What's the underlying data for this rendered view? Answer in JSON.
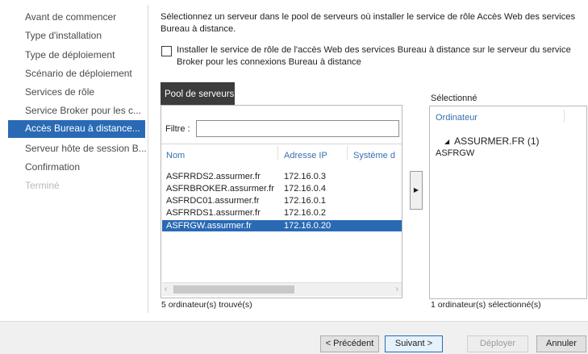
{
  "nav": {
    "items": [
      {
        "label": "Avant de commencer",
        "state": "normal"
      },
      {
        "label": "Type d'installation",
        "state": "normal"
      },
      {
        "label": "Type de déploiement",
        "state": "normal"
      },
      {
        "label": "Scénario de déploiement",
        "state": "normal"
      },
      {
        "label": "Services de rôle",
        "state": "normal"
      },
      {
        "label": "Service Broker pour les c...",
        "state": "normal"
      },
      {
        "label": "Accès Bureau à distance...",
        "state": "active"
      },
      {
        "label": "Serveur hôte de session B...",
        "state": "normal"
      },
      {
        "label": "Confirmation",
        "state": "normal"
      },
      {
        "label": "Terminé",
        "state": "disabled"
      }
    ]
  },
  "main": {
    "description": "Sélectionnez un serveur dans le pool de serveurs où installer le service de rôle Accès Web des services Bureau à distance.",
    "checkbox_label": "Installer le service de rôle de l'accès Web des services Bureau à distance sur le serveur du service Broker pour les connexions Bureau à distance",
    "checkbox_checked": false
  },
  "pool": {
    "tab_label": "Pool de serveurs",
    "filter_label": "Filtre :",
    "filter_value": "",
    "columns": [
      "Nom",
      "Adresse IP",
      "Système d"
    ],
    "rows": [
      {
        "name": "ASFRRDS2.assurmer.fr",
        "ip": "172.16.0.3",
        "selected": false
      },
      {
        "name": "ASFRBROKER.assurmer.fr",
        "ip": "172.16.0.4",
        "selected": false
      },
      {
        "name": "ASFRDC01.assurmer.fr",
        "ip": "172.16.0.1",
        "selected": false
      },
      {
        "name": "ASFRRDS1.assurmer.fr",
        "ip": "172.16.0.2",
        "selected": false
      },
      {
        "name": "ASFRGW.assurmer.fr",
        "ip": "172.16.0.20",
        "selected": true
      }
    ],
    "found_count": "5 ordinateur(s) trouvé(s)"
  },
  "selected": {
    "title": "Sélectionné",
    "column": "Ordinateur",
    "group": "ASSURMER.FR (1)",
    "items": [
      "ASFRGW"
    ],
    "count": "1 ordinateur(s) sélectionné(s)"
  },
  "footer": {
    "prev_label": "< Précédent",
    "next_label": "Suivant >",
    "deploy_label": "Déployer",
    "cancel_label": "Annuler"
  },
  "icons": {
    "move_right": "arrow-right-icon",
    "group_expand": "triangle-down-icon",
    "scroll_left": "chevron-left-icon",
    "scroll_right": "chevron-right-icon"
  },
  "colors": {
    "accent": "#2a6ab5",
    "header_text": "#3a6fb0",
    "pool_tab": "#3c3c3c"
  }
}
